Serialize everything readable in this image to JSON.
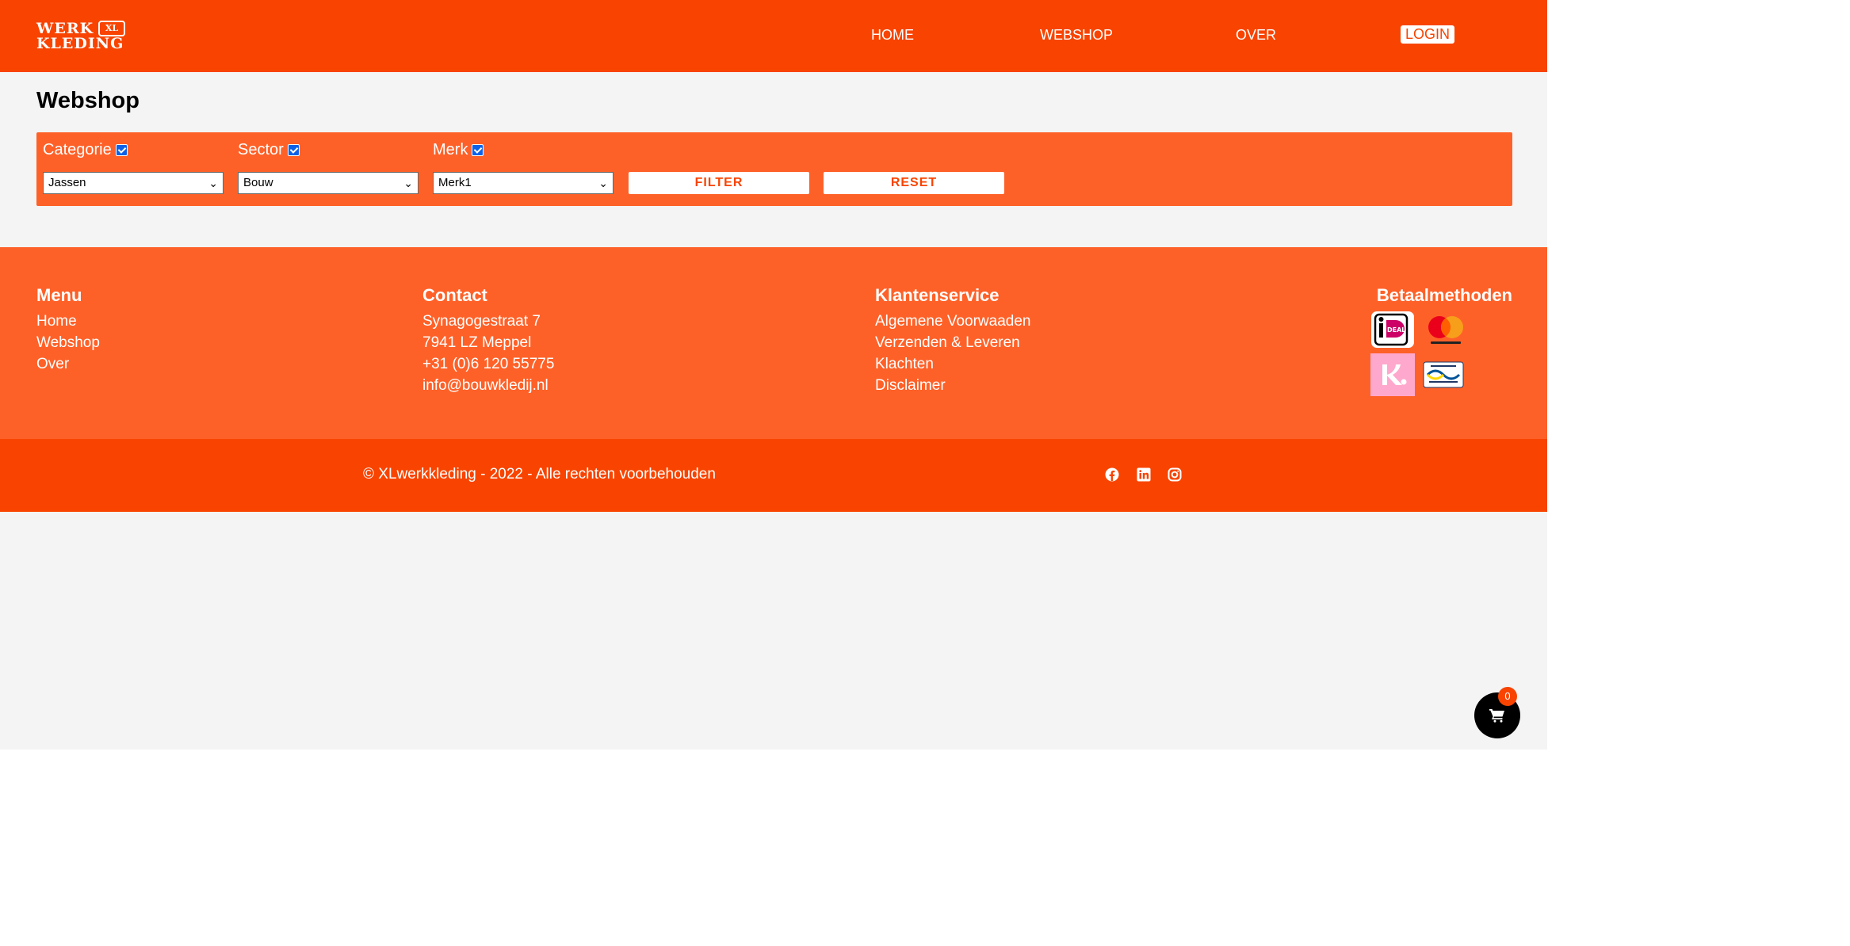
{
  "brand": {
    "line1": "WERK",
    "line2": "KLEDING",
    "badge": "XL"
  },
  "nav": {
    "home": "HOME",
    "webshop": "WEBSHOP",
    "over": "OVER",
    "login": "LOGIN"
  },
  "page": {
    "title": "Webshop"
  },
  "filters": {
    "categorie": {
      "label": "Categorie",
      "checked": true,
      "selected": "Jassen"
    },
    "sector": {
      "label": "Sector",
      "checked": true,
      "selected": "Bouw"
    },
    "merk": {
      "label": "Merk",
      "checked": true,
      "selected": "Merk1"
    },
    "filter_button": "FILTER",
    "reset_button": "RESET"
  },
  "footer": {
    "menu": {
      "title": "Menu",
      "items": [
        "Home",
        "Webshop",
        "Over"
      ]
    },
    "contact": {
      "title": "Contact",
      "lines": [
        "Synagogestraat 7",
        "7941 LZ Meppel",
        "+31 (0)6 120 55775",
        "info@bouwkledij.nl"
      ]
    },
    "klantenservice": {
      "title": "Klantenservice",
      "items": [
        "Algemene Voorwaaden",
        "Verzenden & Leveren",
        "Klachten",
        "Disclaimer"
      ]
    },
    "betaalmethoden": {
      "title": "Betaalmethoden",
      "methods": [
        "ideal-icon",
        "mastercard-icon",
        "klarna-icon",
        "bancontact-icon"
      ]
    }
  },
  "bottom": {
    "copyright": "© XLwerkkleding - 2022 - Alle rechten voorbehouden",
    "social": [
      "facebook-icon",
      "linkedin-icon",
      "instagram-icon"
    ]
  },
  "cart": {
    "count": "0"
  },
  "colors": {
    "primary": "#f84400",
    "secondary": "#fe6128",
    "background": "#f4f4f4"
  }
}
